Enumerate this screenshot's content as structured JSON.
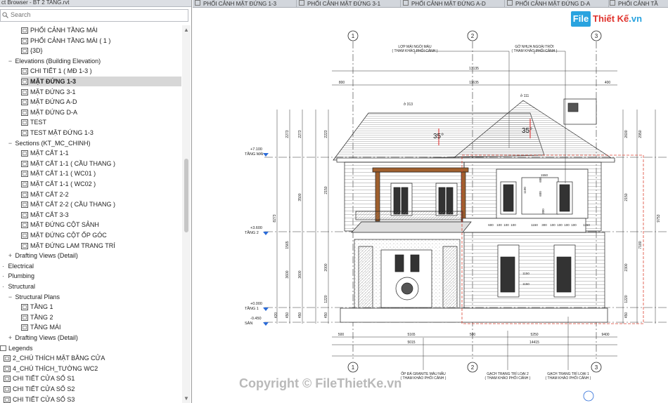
{
  "project_browser": {
    "title": "ct Browser - BT 2 TANG.rvt",
    "search_placeholder": "Search"
  },
  "tree": [
    {
      "label": "PHỐI CẢNH TẦNG MÁI",
      "indent": 3,
      "icon": "view"
    },
    {
      "label": "PHỐI CẢNH TẦNG MÁI ( 1 )",
      "indent": 3,
      "icon": "view"
    },
    {
      "label": "{3D}",
      "indent": 3,
      "icon": "view"
    },
    {
      "label": "Elevations (Building Elevation)",
      "indent": 1,
      "toggle": "−",
      "group": true
    },
    {
      "label": "CHI TIẾT 1 ( MĐ 1-3 )",
      "indent": 3,
      "icon": "view"
    },
    {
      "label": "MẶT ĐỨNG 1-3",
      "indent": 3,
      "icon": "view",
      "selected": true
    },
    {
      "label": "MẶT ĐỨNG 3-1",
      "indent": 3,
      "icon": "view"
    },
    {
      "label": "MẶT ĐỨNG A-D",
      "indent": 3,
      "icon": "view"
    },
    {
      "label": "MẶT ĐỨNG D-A",
      "indent": 3,
      "icon": "view"
    },
    {
      "label": "TEST",
      "indent": 3,
      "icon": "view"
    },
    {
      "label": "TEST MẶT ĐỨNG 1-3",
      "indent": 3,
      "icon": "view"
    },
    {
      "label": "Sections (KT_MC_CHINH)",
      "indent": 1,
      "toggle": "−",
      "group": true
    },
    {
      "label": "MẶT CẮT 1-1",
      "indent": 3,
      "icon": "view"
    },
    {
      "label": "MẶT CẮT 1-1 ( CẦU THANG )",
      "indent": 3,
      "icon": "view"
    },
    {
      "label": "MẶT CẮT 1-1 ( WC01 )",
      "indent": 3,
      "icon": "view"
    },
    {
      "label": "MẶT CẮT 1-1 ( WC02 )",
      "indent": 3,
      "icon": "view"
    },
    {
      "label": "MẶT CẮT 2-2",
      "indent": 3,
      "icon": "view"
    },
    {
      "label": "MẶT CẮT 2-2 ( CẦU THANG )",
      "indent": 3,
      "icon": "view"
    },
    {
      "label": "MẶT CẮT 3-3",
      "indent": 3,
      "icon": "view"
    },
    {
      "label": "MẶT ĐỨNG CỘT SẢNH",
      "indent": 3,
      "icon": "view"
    },
    {
      "label": "MẶT ĐỨNG CỘT ỐP GÓC",
      "indent": 3,
      "icon": "view"
    },
    {
      "label": "MẶT ĐỨNG LAM TRANG TRÍ",
      "indent": 3,
      "icon": "view"
    },
    {
      "label": "Drafting Views (Detail)",
      "indent": 1,
      "toggle": "+",
      "group": true
    },
    {
      "label": "Electrical",
      "indent": 0,
      "toggle": "·",
      "group": true
    },
    {
      "label": "Plumbing",
      "indent": 0,
      "toggle": "·",
      "group": true
    },
    {
      "label": "Structural",
      "indent": 0,
      "toggle": "·",
      "group": true
    },
    {
      "label": "Structural Plans",
      "indent": 1,
      "toggle": "−",
      "group": true
    },
    {
      "label": "TẦNG 1",
      "indent": 3,
      "icon": "view"
    },
    {
      "label": "TẦNG 2",
      "indent": 3,
      "icon": "view"
    },
    {
      "label": "TẦNG MÁI",
      "indent": 3,
      "icon": "view"
    },
    {
      "label": "Drafting Views (Detail)",
      "indent": 1,
      "toggle": "+",
      "group": true
    },
    {
      "label": "Legends",
      "indent": 0,
      "icon": "grid",
      "group": true
    },
    {
      "label": "2_CHÚ THÍCH MẶT BẰNG CỬA",
      "indent": 0.5,
      "icon": "view"
    },
    {
      "label": "4_CHÚ THÍCH_TƯỜNG WC2",
      "indent": 0.5,
      "icon": "view"
    },
    {
      "label": "CHI TIẾT CỬA SỔ S1",
      "indent": 0.5,
      "icon": "view"
    },
    {
      "label": "CHI TIẾT CỬA SỔ S2",
      "indent": 0.5,
      "icon": "view"
    },
    {
      "label": "CHI TIẾT CỬA SỔ S3",
      "indent": 0.5,
      "icon": "view"
    }
  ],
  "tabs": [
    "PHỐI CẢNH MẶT ĐỨNG 1-3",
    "PHỐI CẢNH MẶT ĐỨNG 3-1",
    "PHỐI CẢNH MẶT ĐỨNG A-D",
    "PHỐI CẢNH MẶT ĐỨNG D-A",
    "PHỐI CẢNH TẦ"
  ],
  "drawing": {
    "grids": [
      "1",
      "2",
      "3"
    ],
    "annotations": {
      "roof_tile": "LỢP MÁI NGÓI MÀU",
      "roof_tile_sub": "( THAM KHẢO PHỐI CẢNH )",
      "gutter": "GỜ NHỰA NGOÀI TRỜI",
      "gutter_sub": "( THAM KHẢO PHỐI CẢNH )",
      "granite": "ỐP ĐÁ GRANITE MÀU NÂU",
      "granite_sub": "( THAM KHẢO PHỐI CẢNH )",
      "tile2": "GẠCH TRANG TRÍ LOẠI 2",
      "tile2_sub": "( THAM KHẢO PHỐI CẢNH )",
      "tile1": "GẠCH TRANG TRÍ LOẠI 1",
      "tile1_sub": "( THAM KHẢO PHỐI CẢNH )"
    },
    "levels": [
      {
        "elev": "+7.100",
        "name": "TẦNG MÁI"
      },
      {
        "elev": "+3.600",
        "name": "TẦNG 2"
      },
      {
        "elev": "+0.000",
        "name": "TẦNG 1"
      },
      {
        "elev": "-0.450",
        "name": "SÂN"
      }
    ],
    "top_dims": [
      "13135",
      "800",
      "11635",
      "400"
    ],
    "bottom_dims": [
      "5165",
      "500",
      "5250",
      "500",
      "9400",
      "5015",
      "14415"
    ],
    "slope_tags": [
      "35°",
      "35°"
    ],
    "spot_tags": [
      "ở 313",
      "ở 111"
    ],
    "left_dims": [
      "2273",
      "2273",
      "2223",
      "3500",
      "2150",
      "8273",
      "1565",
      "3600",
      "3600",
      "2000",
      "1220",
      "450",
      "450",
      "450",
      "420"
    ],
    "right_dims": [
      "2600",
      "2950",
      "2150",
      "9753",
      "7180",
      "2300",
      "1220",
      "450"
    ],
    "window_dims": [
      "600",
      "100",
      "100",
      "100",
      "1150",
      "300",
      "100",
      "100",
      "100",
      "100",
      "1150",
      "1550",
      "1150",
      "1150",
      "1100",
      "600",
      "600",
      "300"
    ]
  },
  "watermark": {
    "file": "File",
    "brand": "Thiết Kế",
    ".vn": ".vn",
    "copyright": "Copyright © FileThietKe.vn"
  }
}
